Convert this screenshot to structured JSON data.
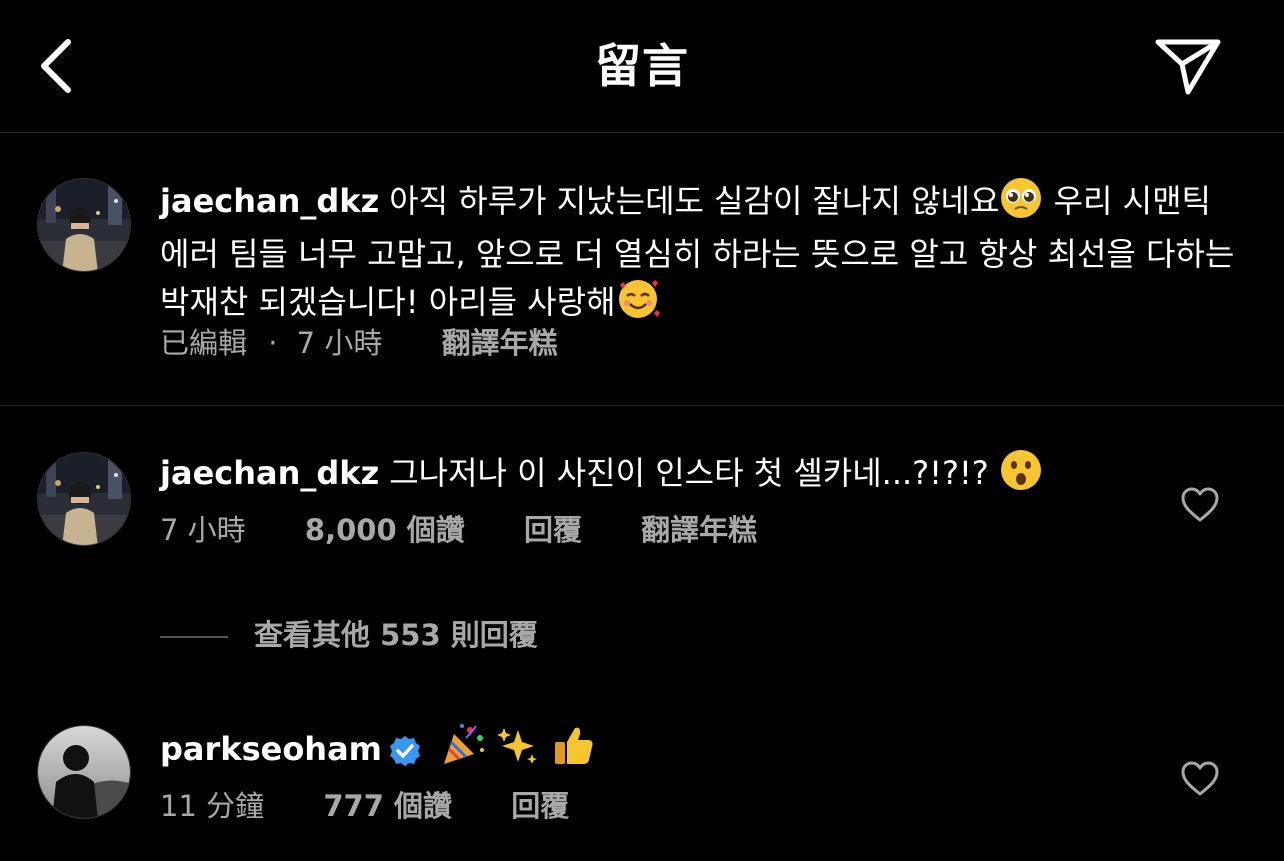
{
  "header": {
    "title": "留言"
  },
  "caption": {
    "username": "jaechan_dkz",
    "text_part1": "아직 하루가 지났는데도 실감이 잘나지 않네요",
    "text_part2": "우리 시맨틱 에러 팀들 너무 고맙고, 앞으로 더 열심히 하라는 뜻으로 알고 항상 최선을 다하는 박재찬 되겠습니다! 아리들 사랑해",
    "edited": "已編輯",
    "dot": "·",
    "time": "7 小時",
    "translate": "翻譯年糕"
  },
  "comment1": {
    "username": "jaechan_dkz",
    "text": "그나저나 이 사진이 인스타 첫 셀카네...?!?!?",
    "time": "7 小時",
    "likes": "8,000 個讚",
    "reply": "回覆",
    "translate": "翻譯年糕"
  },
  "view_replies": "查看其他 553 則回覆",
  "comment2": {
    "username": "parkseoham",
    "time": "11 分鐘",
    "likes": "777 個讚",
    "reply": "回覆"
  },
  "icons": {
    "back": "chevron-left-icon",
    "share": "paper-plane-icon",
    "like": "heart-outline-icon",
    "verified": "verified-badge-icon"
  },
  "colors": {
    "verified": "#3897f0",
    "meta": "#a8a8a8",
    "divider": "#262626"
  }
}
